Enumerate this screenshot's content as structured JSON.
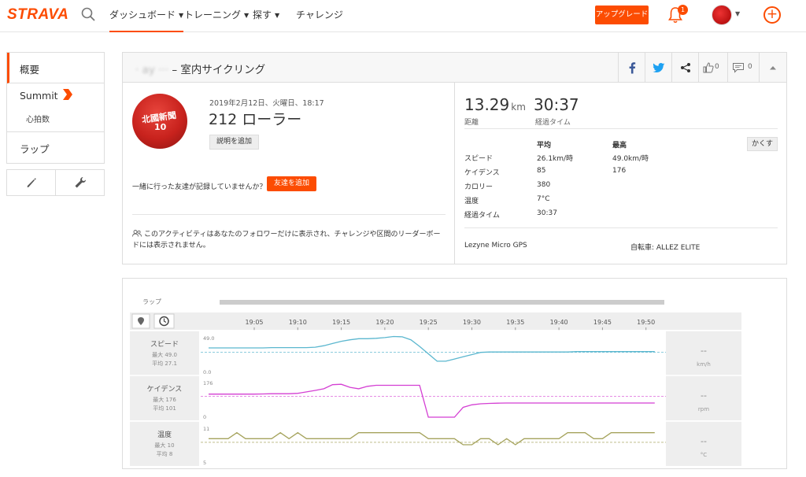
{
  "nav": {
    "logo": "STRAVA",
    "items": [
      {
        "label": "ダッシュボード",
        "active": true
      },
      {
        "label": "トレーニング",
        "active": false
      },
      {
        "label": "探す",
        "active": false
      },
      {
        "label": "チャレンジ",
        "active": false
      }
    ],
    "upgrade_label": "アップグレード",
    "notification_count": "1"
  },
  "sidebar": {
    "overview": "概要",
    "summit": "Summit",
    "heart_rate": "心拍数",
    "laps": "ラップ"
  },
  "activity": {
    "athlete_name_blurred": "· ay   ···",
    "title_suffix": "– 室内サイクリング",
    "share_counts": {
      "kudos": "0",
      "comments": "0"
    },
    "date": "2019年2月12日、火曜日、18:17",
    "name": "212 ローラー",
    "add_description": "説明を追加",
    "jersey_text": "北國新聞",
    "jersey_number": "10",
    "friends_question": "一緒に行った友達が記録していませんか？",
    "add_friends": "友達を追加",
    "privacy_note": "このアクティビティはあなたのフォロワーだけに表示され、チャレンジや区間のリーダーボードには表示されません。",
    "distance": {
      "value": "13.29",
      "unit": "km",
      "label": "距離"
    },
    "elapsed": {
      "value": "30:37",
      "label": "経過タイム"
    },
    "hide_label": "かくす",
    "stats_headers": {
      "avg": "平均",
      "max": "最高"
    },
    "stats": [
      {
        "label": "スピード",
        "avg": "26.1km/時",
        "max": "49.0km/時"
      },
      {
        "label": "ケイデンス",
        "avg": "85",
        "max": "176"
      },
      {
        "label": "カロリー",
        "avg": "380",
        "max": ""
      },
      {
        "label": "温度",
        "avg": "7°C",
        "max": ""
      },
      {
        "label": "経過タイム",
        "avg": "30:37",
        "max": ""
      }
    ],
    "device": "Lezyne Micro GPS",
    "bike": "自転車: ALLEZ ELITE"
  },
  "chart_data": {
    "type": "line",
    "laps_label": "ラップ",
    "time_ticks": [
      "19:05",
      "19:10",
      "19:15",
      "19:20",
      "19:25",
      "19:30",
      "19:35",
      "19:40",
      "19:45",
      "19:50"
    ],
    "x_minutes": [
      0,
      1,
      2,
      3,
      4,
      5,
      6,
      7,
      8,
      9,
      10,
      11,
      12,
      13,
      14,
      15,
      16,
      17,
      18,
      19,
      20,
      21,
      22,
      23,
      24,
      25,
      26,
      27,
      28,
      29,
      30,
      31,
      32,
      33,
      34,
      35,
      36,
      37,
      38,
      39,
      40,
      41,
      42,
      43,
      44,
      45,
      46,
      47,
      48,
      49,
      50
    ],
    "x_start": "19:01",
    "panels": [
      {
        "name": "スピード",
        "max_label": "最大 49.0",
        "avg_label": "平均 27.1",
        "ymax_tick": "49.0",
        "ymin_tick": "0.0",
        "ylim": [
          0,
          49
        ],
        "avg": 27.1,
        "unit": "km/h",
        "current": "--",
        "color": "#5bb7cf",
        "values": [
          33,
          33,
          33,
          33,
          33,
          33,
          33.5,
          33.5,
          33.5,
          33.5,
          33.5,
          34,
          36,
          39,
          42,
          44,
          45.5,
          45.5,
          46,
          47,
          48.5,
          48,
          44,
          35,
          25,
          15,
          15,
          18,
          21,
          24,
          27,
          27.5,
          27.5,
          27.5,
          27.5,
          27.5,
          27.5,
          27.5,
          27.5,
          27.5,
          27.5,
          28,
          28,
          28,
          28,
          28,
          28,
          28,
          28,
          28,
          28
        ]
      },
      {
        "name": "ケイデンス",
        "max_label": "最大 176",
        "avg_label": "平均 101",
        "ymax_tick": "176",
        "ymin_tick": "0",
        "ylim": [
          0,
          176
        ],
        "avg": 101,
        "unit": "rpm",
        "current": "--",
        "color": "#d43fd3",
        "values": [
          112,
          112,
          112,
          112,
          112,
          113,
          114,
          114,
          114,
          116,
          123,
          130,
          138,
          158,
          160,
          145,
          138,
          150,
          155,
          155,
          155,
          155,
          155,
          155,
          0,
          0,
          0,
          0,
          48,
          60,
          65,
          67,
          68,
          69,
          69,
          69,
          69,
          69,
          69,
          69,
          69,
          69,
          69,
          69,
          69,
          69,
          69,
          69,
          69,
          69,
          69
        ]
      },
      {
        "name": "温度",
        "max_label": "最大 10",
        "avg_label": "平均 8",
        "ymax_tick": "11",
        "ymin_tick": "5",
        "ylim": [
          5,
          11
        ],
        "avg": 8.4,
        "unit": "°C",
        "current": "--",
        "color": "#a5a35c",
        "values": [
          9,
          9,
          10,
          9,
          9,
          9,
          9,
          10,
          9,
          10,
          9,
          9,
          9,
          9,
          9,
          9,
          10,
          10,
          10,
          10,
          10,
          10,
          10,
          10,
          9,
          9,
          9,
          9,
          8,
          8,
          9,
          9,
          8,
          9,
          8,
          9,
          9,
          9,
          9,
          9,
          10,
          10,
          10,
          9,
          9,
          10,
          10,
          10,
          10,
          10,
          10
        ]
      }
    ]
  }
}
